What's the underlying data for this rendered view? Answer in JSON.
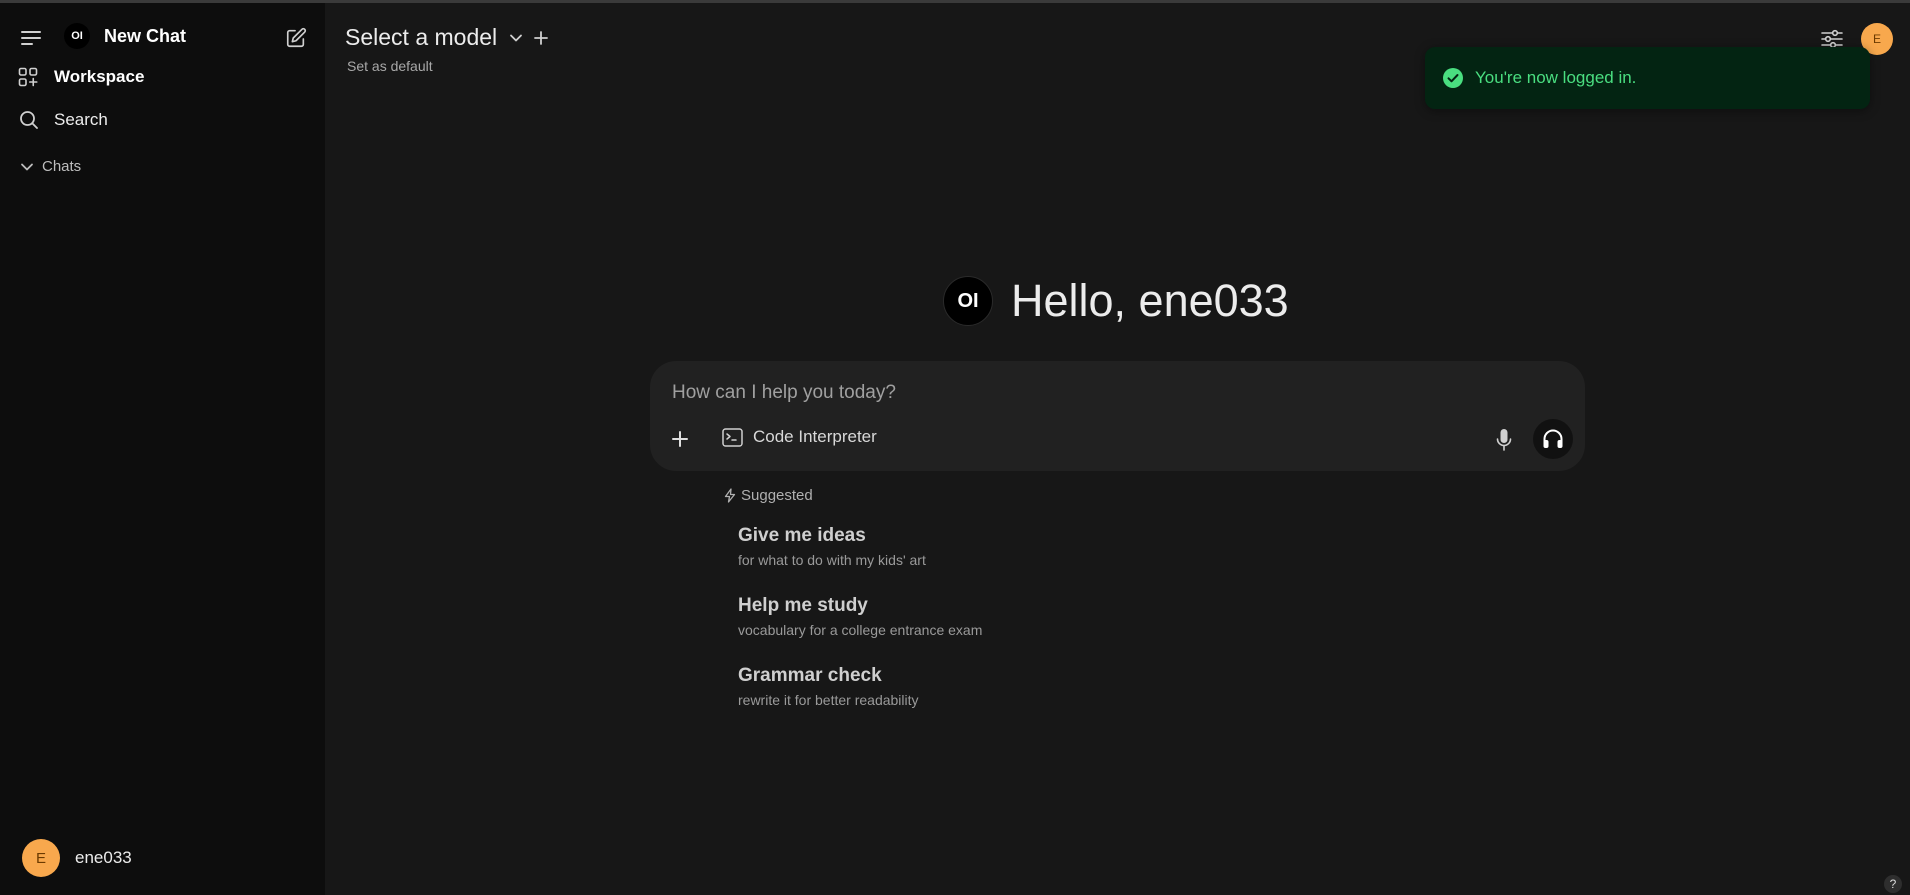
{
  "sidebar": {
    "title": "New Chat",
    "logo_text": "OI",
    "items": [
      {
        "label": "Workspace",
        "icon": "grid-plus-icon"
      },
      {
        "label": "Search",
        "icon": "search-icon"
      }
    ],
    "chats_label": "Chats",
    "user": {
      "initial": "E",
      "name": "ene033"
    }
  },
  "header": {
    "model_title": "Select a model",
    "set_default": "Set as default",
    "avatar_initial": "E"
  },
  "toast": {
    "message": "You're now logged in."
  },
  "greeting": {
    "logo_text": "OI",
    "text": "Hello, ene033"
  },
  "composer": {
    "placeholder": "How can I help you today?",
    "code_interpreter_label": "Code Interpreter"
  },
  "suggested": {
    "label": "Suggested",
    "items": [
      {
        "title": "Give me ideas",
        "subtitle": "for what to do with my kids' art"
      },
      {
        "title": "Help me study",
        "subtitle": "vocabulary for a college entrance exam"
      },
      {
        "title": "Grammar check",
        "subtitle": "rewrite it for better readability"
      }
    ]
  },
  "help": {
    "label": "?"
  },
  "colors": {
    "sidebar_bg": "#0d0d0d",
    "main_bg": "#171717",
    "composer_bg": "#212121",
    "avatar": "#f8a84d",
    "toast_bg": "#032412",
    "toast_text": "#4ade80"
  }
}
